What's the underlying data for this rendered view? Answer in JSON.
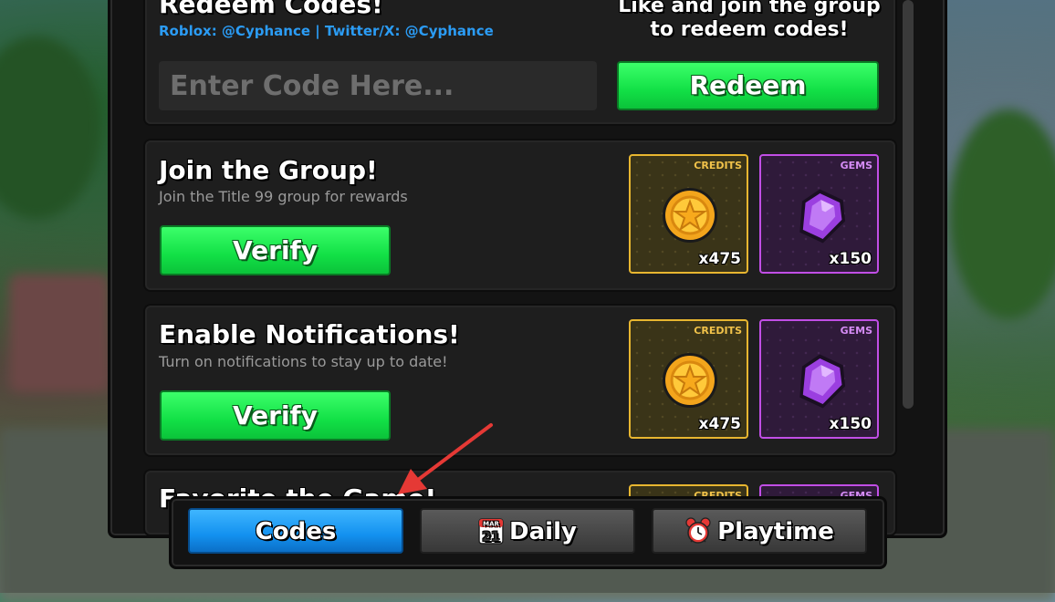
{
  "redeem": {
    "title": "Redeem Codes!",
    "social": "Roblox: @Cyphance | Twitter/X: @Cyphance",
    "group_hint": "Like and join the group to redeem codes!",
    "input_placeholder": "Enter Code Here...",
    "button_label": "Redeem"
  },
  "cards": [
    {
      "title": "Join the Group!",
      "subtitle": "Join the Title 99 group for rewards",
      "button_label": "Verify",
      "rewards": [
        {
          "label": "CREDITS",
          "amount": "x475",
          "icon": "coin-icon"
        },
        {
          "label": "GEMS",
          "amount": "x150",
          "icon": "gem-icon"
        }
      ]
    },
    {
      "title": "Enable Notifications!",
      "subtitle": "Turn on notifications to stay up to date!",
      "button_label": "Verify",
      "rewards": [
        {
          "label": "CREDITS",
          "amount": "x475",
          "icon": "coin-icon"
        },
        {
          "label": "GEMS",
          "amount": "x150",
          "icon": "gem-icon"
        }
      ]
    },
    {
      "title": "Favorite the Game!",
      "rewards": [
        {
          "label": "CREDITS"
        },
        {
          "label": "GEMS"
        }
      ]
    }
  ],
  "tabs": [
    {
      "label": "Codes",
      "active": true
    },
    {
      "label": "Daily",
      "active": false,
      "icon": "calendar-icon",
      "icon_month": "MAR",
      "icon_day": "21"
    },
    {
      "label": "Playtime",
      "active": false,
      "icon": "alarm-clock-icon"
    }
  ],
  "colors": {
    "accent_green": "#12e046",
    "active_tab_blue": "#1391ef",
    "credits_gold": "#e8b630",
    "gems_purple": "#c14ee6",
    "link_blue": "#2b9cf5",
    "annotation_arrow": "#e53935"
  }
}
